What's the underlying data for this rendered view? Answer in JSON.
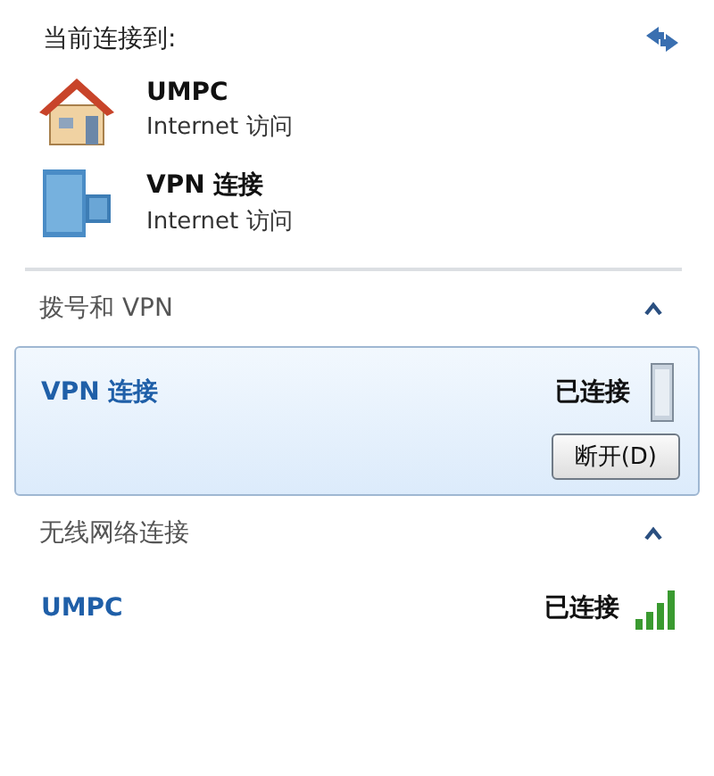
{
  "header": {
    "title": "当前连接到:"
  },
  "current_connections": [
    {
      "name": "UMPC",
      "access": "Internet 访问",
      "kind": "home"
    },
    {
      "name": "VPN 连接",
      "access": "Internet 访问",
      "kind": "vpn"
    }
  ],
  "sections": [
    {
      "title": "拨号和 VPN",
      "expanded": true,
      "items": [
        {
          "name": "VPN 连接",
          "status": "已连接",
          "selected": true,
          "kind": "vpn",
          "button": "断开(D)"
        }
      ]
    },
    {
      "title": "无线网络连接",
      "expanded": true,
      "items": [
        {
          "name": "UMPC",
          "status": "已连接",
          "selected": false,
          "kind": "wifi"
        }
      ]
    }
  ]
}
